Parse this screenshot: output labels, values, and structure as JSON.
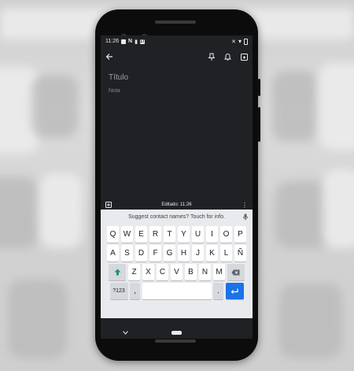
{
  "status": {
    "time": "11:26",
    "calendar_day": "17"
  },
  "toolbar": {
    "back_icon": "arrow-left-icon",
    "pin_icon": "pin-icon",
    "reminder_icon": "bell-plus-icon",
    "archive_icon": "archive-icon"
  },
  "note": {
    "title_placeholder": "Título",
    "body_placeholder": "Nota"
  },
  "bottom_bar": {
    "edited_label": "Editado: 11:26"
  },
  "keyboard": {
    "suggestion": "Suggest contact names? Touch for info.",
    "row1": [
      "Q",
      "W",
      "E",
      "R",
      "T",
      "Y",
      "U",
      "I",
      "O",
      "P"
    ],
    "row2": [
      "A",
      "S",
      "D",
      "F",
      "G",
      "H",
      "J",
      "K",
      "L",
      "Ñ"
    ],
    "row3": [
      "Z",
      "X",
      "C",
      "V",
      "B",
      "N",
      "M"
    ],
    "num_key": "?123",
    "comma_key": ",",
    "period_key": ".",
    "accent_color": "#1a73e8"
  },
  "colors": {
    "screen_bg": "#202124",
    "keyboard_bg": "#e8eaed"
  }
}
